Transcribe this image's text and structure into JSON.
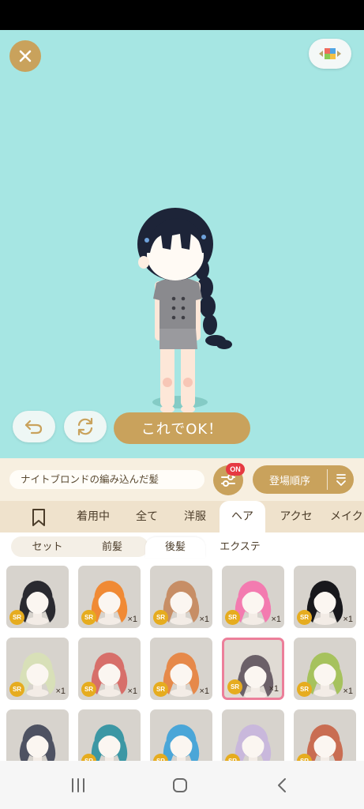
{
  "header": {
    "close_icon": "close-icon",
    "layout_icon": "color-grid-icon"
  },
  "actions": {
    "undo_icon": "undo-icon",
    "rotate_icon": "rotate-icon",
    "ok_label": "これでOK！"
  },
  "controls": {
    "item_name": "ナイトブロンドの編み込んだ髪",
    "filter_icon": "sliders-icon",
    "filter_badge": "ON",
    "sort_label": "登場順序",
    "sort_icon": "sort-icon"
  },
  "category_tabs": [
    {
      "label": "着用中"
    },
    {
      "label": "全て"
    },
    {
      "label": "洋服"
    },
    {
      "label": "ヘア",
      "active": true
    },
    {
      "label": "アクセ"
    },
    {
      "label": "メイク"
    }
  ],
  "sub_tabs": [
    {
      "label": "セット"
    },
    {
      "label": "前髪"
    },
    {
      "label": "後髪",
      "active": true
    },
    {
      "label": "エクステ"
    }
  ],
  "items": [
    {
      "rarity": "SR",
      "count": "",
      "hair": "#2a2a30"
    },
    {
      "rarity": "SR",
      "count": "×1",
      "hair": "#f08a35"
    },
    {
      "rarity": "SR",
      "count": "×1",
      "hair": "#c78e66"
    },
    {
      "rarity": "SR",
      "count": "×1",
      "hair": "#f37bb0"
    },
    {
      "rarity": "SR",
      "count": "×1",
      "hair": "#18181c"
    },
    {
      "rarity": "SR",
      "count": "×1",
      "hair": "#d8e0b8"
    },
    {
      "rarity": "SR",
      "count": "×1",
      "hair": "#d76f6a"
    },
    {
      "rarity": "SR",
      "count": "×1",
      "hair": "#e6894a"
    },
    {
      "rarity": "SR",
      "count": "×1",
      "hair": "#6b6068",
      "selected": true
    },
    {
      "rarity": "SR",
      "count": "×1",
      "hair": "#a6c25d"
    },
    {
      "rarity": "",
      "count": "",
      "hair": "#4e5262"
    },
    {
      "rarity": "SR",
      "count": "",
      "hair": "#3c97a4"
    },
    {
      "rarity": "SR",
      "count": "",
      "hair": "#4aa6d8"
    },
    {
      "rarity": "SR",
      "count": "",
      "hair": "#c9b8dc"
    },
    {
      "rarity": "SR",
      "count": "",
      "hair": "#c96d52"
    }
  ],
  "navbar": {
    "recents_icon": "recents-icon",
    "home_icon": "home-icon",
    "back_icon": "back-icon"
  },
  "colors": {
    "gold": "#c9a25c",
    "stage": "#a6e6e3",
    "badge": "#e63a42",
    "selected_border": "#ec7f9a"
  }
}
